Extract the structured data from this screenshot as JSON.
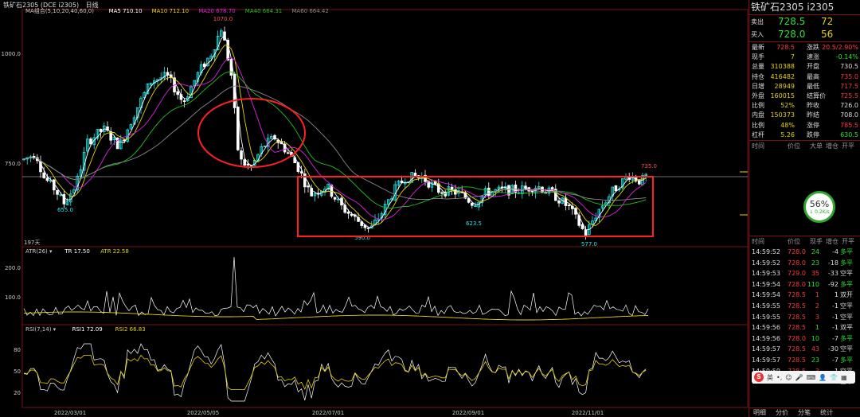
{
  "title": {
    "symbol": "铁矿石2305 (DCE i2305)",
    "period": "日线"
  },
  "ma": {
    "label": "MA组合(5,10,20,40,60,0)",
    "ma5": "MA5 710.10",
    "ma10": "MA10 712.10",
    "ma20": "MA20 678.70",
    "ma40": "MA40 664.31",
    "ma60": "MA60 664.42"
  },
  "atr": {
    "label": "ATR(26)",
    "tr": "TR 17.50",
    "atr": "ATR 22.58"
  },
  "rsi": {
    "label": "RSI(7,14)",
    "rsi1": "RSI1 72.09",
    "rsi2": "RSI2 66.83"
  },
  "chart_labels": {
    "high": "1070.0",
    "low1": "655.0",
    "low2": "590.0",
    "low3": "623.5",
    "low4": "577.0",
    "last_high": "735.0",
    "days": "197天",
    "y1000": "1000.0",
    "y750": "750.0",
    "atr200": "200.0",
    "atr100": "100.0",
    "rsi80": "80",
    "rsi50": "50",
    "rsi20": "20"
  },
  "dates": [
    "2022/03/01",
    "2022/05/05",
    "2022/07/01",
    "2022/09/01",
    "2022/11/01"
  ],
  "colors": {
    "up": "#21e6e6",
    "down": "#ffffff",
    "ma5": "#ffffff",
    "ma10": "#e6d400",
    "ma20": "#e020e0",
    "ma40": "#20c020",
    "ma60": "#888888",
    "box": "#ff2020"
  },
  "chart_data": {
    "type": "candlestick",
    "x_ticks": [
      "2022/03/01",
      "2022/05/05",
      "2022/07/01",
      "2022/09/01",
      "2022/11/01"
    ],
    "y_ticks": [
      750,
      1000
    ],
    "marked_prices": [
      1070.0,
      655.0,
      590.0,
      623.5,
      577.0,
      735.0
    ]
  },
  "panel": {
    "name": "铁矿石2305  i2305",
    "sell": {
      "label": "卖出",
      "price": "728.5",
      "vol": "72"
    },
    "buy": {
      "label": "买入",
      "price": "728.0",
      "vol": "56"
    },
    "stats": [
      [
        "最新",
        "728.5",
        "涨跌",
        "20.5/2.90%"
      ],
      [
        "现手",
        "7",
        "速涨",
        "-0.14%"
      ],
      [
        "总量",
        "310388",
        "开盘",
        "730.5"
      ],
      [
        "持仓",
        "416482",
        "最高",
        "735.0"
      ],
      [
        "日增",
        "28949",
        "最低",
        "717.5"
      ],
      [
        "外盘",
        "160015",
        "结算价",
        "725.5"
      ],
      [
        "比例",
        "52%",
        "昨收",
        "726.0"
      ],
      [
        "内盘",
        "150373",
        "昨结",
        "708.0"
      ],
      [
        "比例",
        "48%",
        "涨停",
        "785.5"
      ],
      [
        "杠杆",
        "5.26",
        "跌停",
        "630.5"
      ]
    ],
    "bigorder_header": [
      "时间",
      "价位",
      "大单",
      "增仓",
      "开平"
    ],
    "speed": {
      "pct": "56%",
      "rate": "↓ 0.2K/s"
    },
    "tick_header": [
      "时间",
      "价位",
      "现手",
      "增仓",
      "开平"
    ],
    "ticks": [
      [
        "14:59:52",
        "728.0",
        "24",
        "-4",
        "多平"
      ],
      [
        "14:59:52",
        "728.0",
        "23",
        "-18",
        "多平"
      ],
      [
        "14:59:53",
        "729.0",
        "35",
        "-33",
        "空平"
      ],
      [
        "14:59:54",
        "728.0",
        "110",
        "-92",
        "多平"
      ],
      [
        "14:59:54",
        "728.5",
        "1",
        "1",
        "双开"
      ],
      [
        "14:59:55",
        "728.5",
        "2",
        "-1",
        "空平"
      ],
      [
        "14:59:55",
        "728.5",
        "3",
        "-1",
        "空平"
      ],
      [
        "14:59:56",
        "728.5",
        "1",
        "-1",
        "双平"
      ],
      [
        "14:59:56",
        "728.0",
        "10",
        "-7",
        "多平"
      ],
      [
        "14:59:57",
        "728.5",
        "43",
        "-30",
        "空平"
      ],
      [
        "14:59:57",
        "728.5",
        "23",
        "-7",
        "多平"
      ],
      [
        "14:59:59",
        "728.5",
        "3",
        "-1",
        "空平"
      ],
      [
        "14:59:59",
        "728.5",
        "7",
        "-1",
        "空平"
      ]
    ],
    "tabs": [
      "明细",
      "分价",
      "分笔",
      "统计"
    ]
  }
}
